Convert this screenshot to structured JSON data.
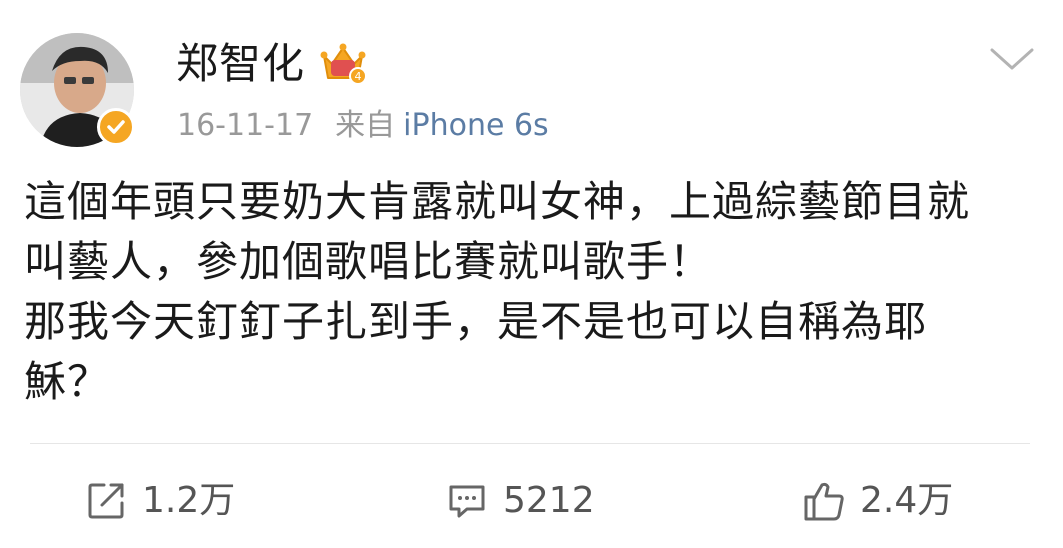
{
  "post": {
    "author": {
      "name": "郑智化",
      "avatar_icon": "avatar-portrait",
      "verified_icon": "verified-check-icon",
      "crown_icon": "crown-icon",
      "crown_level": "4"
    },
    "meta": {
      "time": "16-11-17",
      "source_prefix": "来自",
      "source_device": "iPhone 6s"
    },
    "body": {
      "lines": [
        "這個年頭只要奶大肯露就叫女神，上過綜藝節目就",
        "叫藝人，參加個歌唱比賽就叫歌手！",
        "那我今天釘釘子扎到手，是不是也可以自稱為耶",
        "穌？"
      ]
    },
    "actions": {
      "repost": {
        "icon": "repost-icon",
        "count": "1.2万"
      },
      "comment": {
        "icon": "comment-icon",
        "count": "5212"
      },
      "like": {
        "icon": "thumbs-up-icon",
        "count": "2.4万"
      }
    },
    "colors": {
      "link": "#5b7ca4",
      "meta": "#999999",
      "verified": "#f5a623",
      "crown": "#f5a623"
    }
  }
}
